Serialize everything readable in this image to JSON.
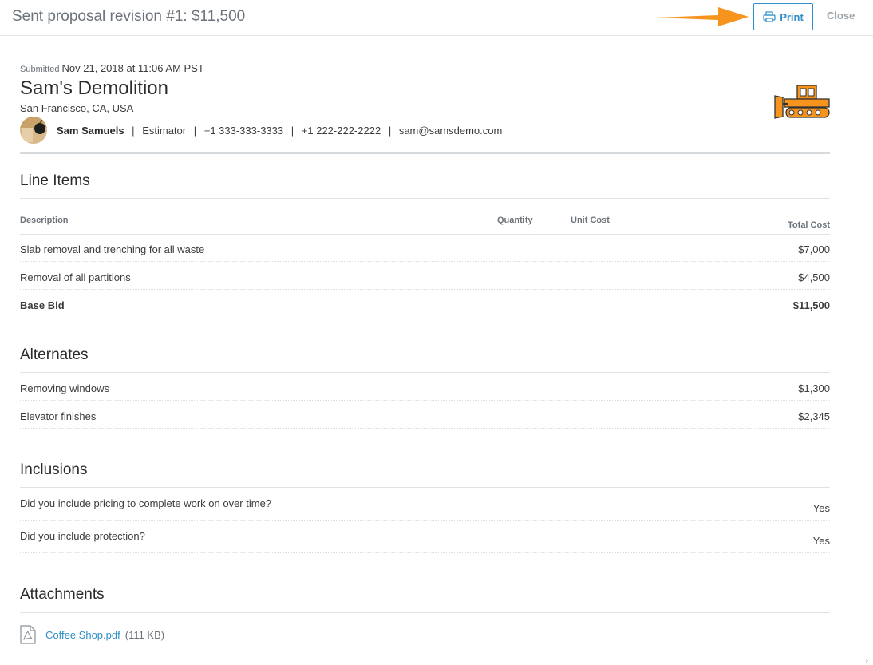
{
  "header": {
    "title": "Sent proposal revision #1: $11,500",
    "print_label": "Print",
    "close_label": "Close",
    "accent_color": "#2f8fc8",
    "arrow_color": "#f7941d"
  },
  "proposal": {
    "submitted_label": "Submitted",
    "submitted_date": "Nov 21, 2018 at 11:06 AM PST",
    "company": "Sam's Demolition",
    "location": "San Francisco, CA, USA",
    "contact": {
      "name": "Sam Samuels",
      "role": "Estimator",
      "phone1": "+1 333-333-3333",
      "phone2": "+1 222-222-2222",
      "email": "sam@samsdemo.com",
      "separator": "|"
    },
    "logo_icon": "bulldozer-icon"
  },
  "line_items": {
    "title": "Line Items",
    "columns": {
      "description": "Description",
      "quantity": "Quantity",
      "unit_cost": "Unit Cost",
      "total_cost": "Total Cost"
    },
    "rows": [
      {
        "description": "Slab removal and trenching for all waste",
        "total": "$7,000"
      },
      {
        "description": "Removal of all partitions",
        "total": "$4,500"
      }
    ],
    "base_bid": {
      "description": "Base Bid",
      "total": "$11,500"
    }
  },
  "alternates": {
    "title": "Alternates",
    "rows": [
      {
        "description": "Removing windows",
        "total": "$1,300"
      },
      {
        "description": "Elevator finishes",
        "total": "$2,345"
      }
    ]
  },
  "inclusions": {
    "title": "Inclusions",
    "rows": [
      {
        "question": "Did you include pricing to complete work on over time?",
        "answer": "Yes"
      },
      {
        "question": "Did you include protection?",
        "answer": "Yes"
      }
    ]
  },
  "attachments": {
    "title": "Attachments",
    "files": [
      {
        "name": "Coffee Shop.pdf",
        "size": "(111 KB)",
        "icon": "pdf-file-icon"
      }
    ]
  }
}
